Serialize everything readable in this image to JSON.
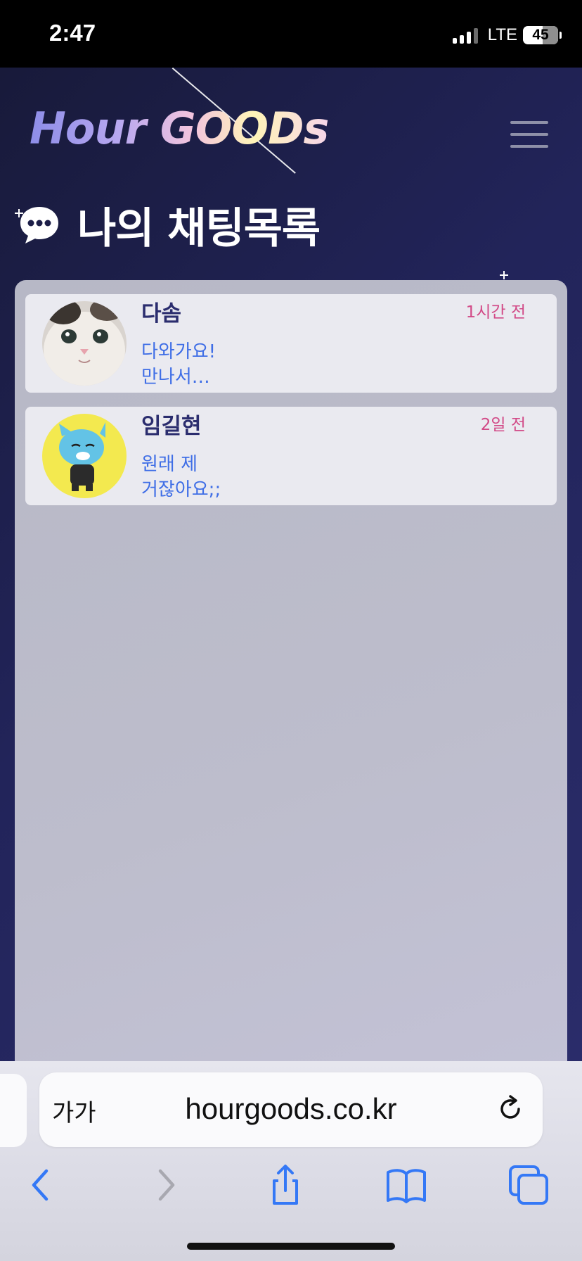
{
  "status_bar": {
    "time": "2:47",
    "network": "LTE",
    "battery": "45"
  },
  "header": {
    "logo_text": "Hour GOODs",
    "menu_icon": "hamburger-menu-icon"
  },
  "page": {
    "title": "나의 채팅목록",
    "title_icon": "chat-bubble-icon"
  },
  "chats": [
    {
      "name": "다솜",
      "time": "1시간 전",
      "preview_line1": "다와가요!",
      "preview_line2": "만나서…",
      "avatar": "cat-photo-avatar"
    },
    {
      "name": "임길현",
      "time": "2일 전",
      "preview_line1": "원래 제",
      "preview_line2": "거잖아요;;",
      "avatar": "cartoon-character-avatar"
    }
  ],
  "browser": {
    "reader_label": "가가",
    "url": "hourgoods.co.kr"
  },
  "colors": {
    "accent_name": "#2b2d6e",
    "time_color": "#d24a87",
    "preview_color": "#3f6ee6",
    "browser_blue": "#3478f6"
  }
}
